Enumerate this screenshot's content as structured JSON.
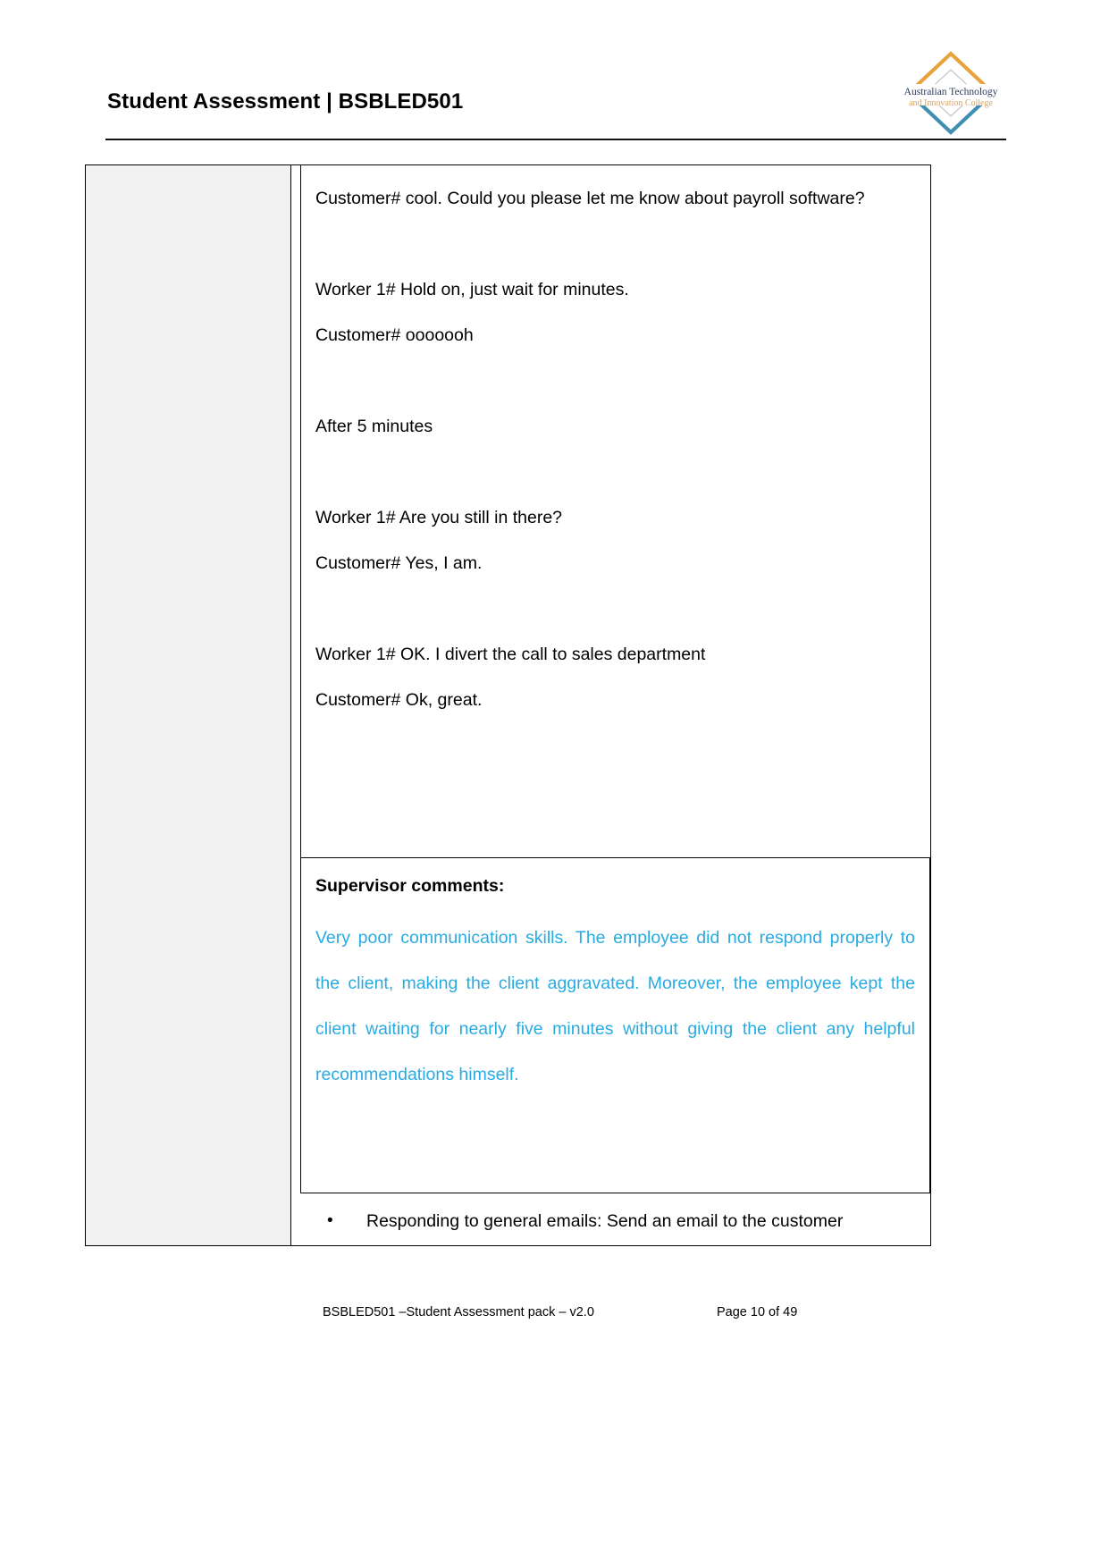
{
  "header": {
    "title": "Student Assessment | BSBLED501",
    "logo": {
      "name": "australian-technology-and-innovation-college-logo",
      "line1": "Australian Technology",
      "line2": "and Innovation College",
      "top_chevron_color": "#E8A33D",
      "bottom_chevron_color": "#3E8FB0",
      "line1_color": "#2A3B5C",
      "line2_color": "#D9A566"
    }
  },
  "table": {
    "left_column_fill": "#f1f1f1",
    "transcript": {
      "lines": [
        "Customer# cool. Could you please let me know about payroll software?",
        "Worker 1# Hold on, just wait for minutes.",
        "Customer# ooooooh",
        "After 5 minutes",
        "Worker 1# Are you still in there?",
        "Customer# Yes, I am.",
        "Worker 1# OK. I divert the call to sales department",
        "Customer# Ok, great."
      ]
    },
    "supervisor_comments": {
      "title": "Supervisor comments:",
      "text": "Very poor communication skills. The employee did not respond properly to the client, making the client aggravated. Moreover, the employee kept the client waiting for nearly five minutes without giving the client any helpful recommendations himself.",
      "text_color": "#29ABE2"
    },
    "bullet": {
      "marker": "•",
      "text": "Responding to general emails: Send an email to the customer"
    }
  },
  "footer": {
    "left": "BSBLED501 –Student Assessment pack – v2.0",
    "right": "Page 10 of 49"
  }
}
